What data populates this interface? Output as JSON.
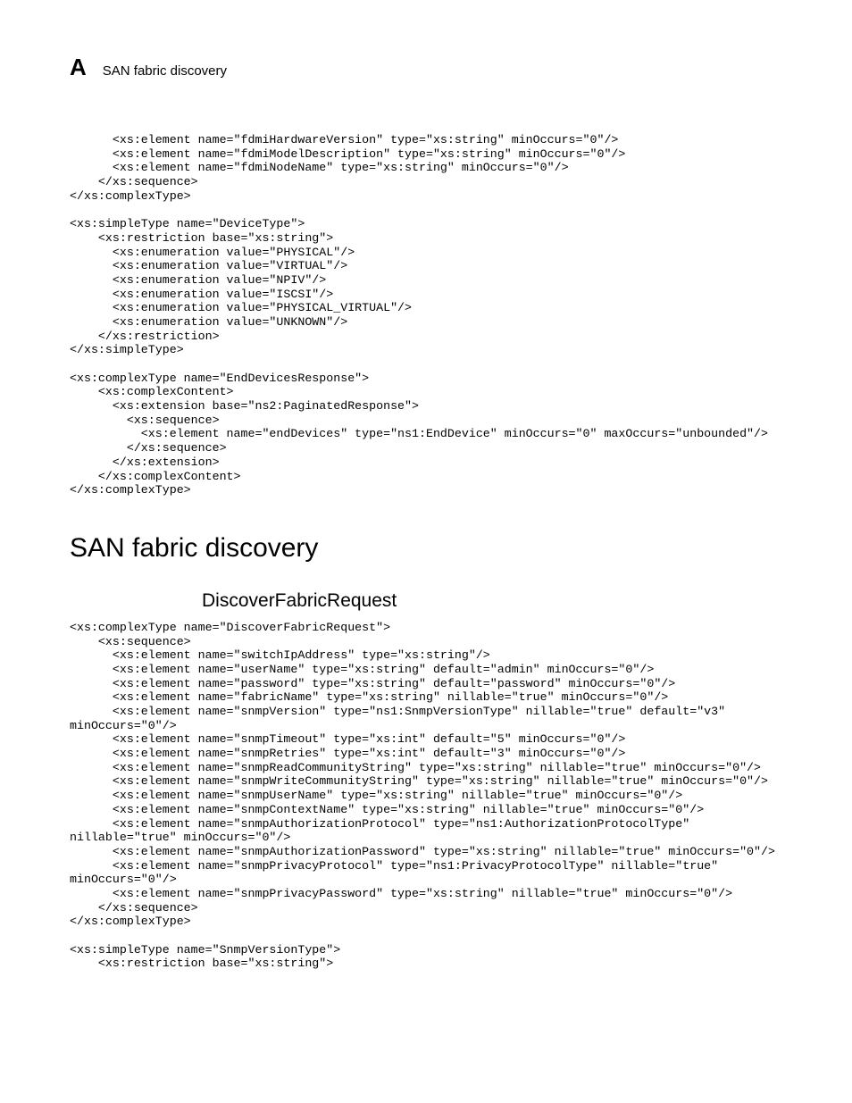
{
  "header": {
    "appendix_letter": "A",
    "title": "SAN fabric discovery"
  },
  "code1": "      <xs:element name=\"fdmiHardwareVersion\" type=\"xs:string\" minOccurs=\"0\"/>\n      <xs:element name=\"fdmiModelDescription\" type=\"xs:string\" minOccurs=\"0\"/>\n      <xs:element name=\"fdmiNodeName\" type=\"xs:string\" minOccurs=\"0\"/>\n    </xs:sequence>\n</xs:complexType>\n\n<xs:simpleType name=\"DeviceType\">\n    <xs:restriction base=\"xs:string\">\n      <xs:enumeration value=\"PHYSICAL\"/>\n      <xs:enumeration value=\"VIRTUAL\"/>\n      <xs:enumeration value=\"NPIV\"/>\n      <xs:enumeration value=\"ISCSI\"/>\n      <xs:enumeration value=\"PHYSICAL_VIRTUAL\"/>\n      <xs:enumeration value=\"UNKNOWN\"/>\n    </xs:restriction>\n</xs:simpleType>\n\n<xs:complexType name=\"EndDevicesResponse\">\n    <xs:complexContent>\n      <xs:extension base=\"ns2:PaginatedResponse\">\n        <xs:sequence>\n          <xs:element name=\"endDevices\" type=\"ns1:EndDevice\" minOccurs=\"0\" maxOccurs=\"unbounded\"/>\n        </xs:sequence>\n      </xs:extension>\n    </xs:complexContent>\n</xs:complexType>",
  "heading1": "SAN fabric discovery",
  "heading2": "DiscoverFabricRequest",
  "code2": "<xs:complexType name=\"DiscoverFabricRequest\">\n    <xs:sequence>\n      <xs:element name=\"switchIpAddress\" type=\"xs:string\"/>\n      <xs:element name=\"userName\" type=\"xs:string\" default=\"admin\" minOccurs=\"0\"/>\n      <xs:element name=\"password\" type=\"xs:string\" default=\"password\" minOccurs=\"0\"/>\n      <xs:element name=\"fabricName\" type=\"xs:string\" nillable=\"true\" minOccurs=\"0\"/>\n      <xs:element name=\"snmpVersion\" type=\"ns1:SnmpVersionType\" nillable=\"true\" default=\"v3\" \nminOccurs=\"0\"/>\n      <xs:element name=\"snmpTimeout\" type=\"xs:int\" default=\"5\" minOccurs=\"0\"/>\n      <xs:element name=\"snmpRetries\" type=\"xs:int\" default=\"3\" minOccurs=\"0\"/>\n      <xs:element name=\"snmpReadCommunityString\" type=\"xs:string\" nillable=\"true\" minOccurs=\"0\"/>\n      <xs:element name=\"snmpWriteCommunityString\" type=\"xs:string\" nillable=\"true\" minOccurs=\"0\"/>\n      <xs:element name=\"snmpUserName\" type=\"xs:string\" nillable=\"true\" minOccurs=\"0\"/>\n      <xs:element name=\"snmpContextName\" type=\"xs:string\" nillable=\"true\" minOccurs=\"0\"/>\n      <xs:element name=\"snmpAuthorizationProtocol\" type=\"ns1:AuthorizationProtocolType\" \nnillable=\"true\" minOccurs=\"0\"/>\n      <xs:element name=\"snmpAuthorizationPassword\" type=\"xs:string\" nillable=\"true\" minOccurs=\"0\"/>\n      <xs:element name=\"snmpPrivacyProtocol\" type=\"ns1:PrivacyProtocolType\" nillable=\"true\" \nminOccurs=\"0\"/>\n      <xs:element name=\"snmpPrivacyPassword\" type=\"xs:string\" nillable=\"true\" minOccurs=\"0\"/>\n    </xs:sequence>\n</xs:complexType>\n\n<xs:simpleType name=\"SnmpVersionType\">\n    <xs:restriction base=\"xs:string\">"
}
